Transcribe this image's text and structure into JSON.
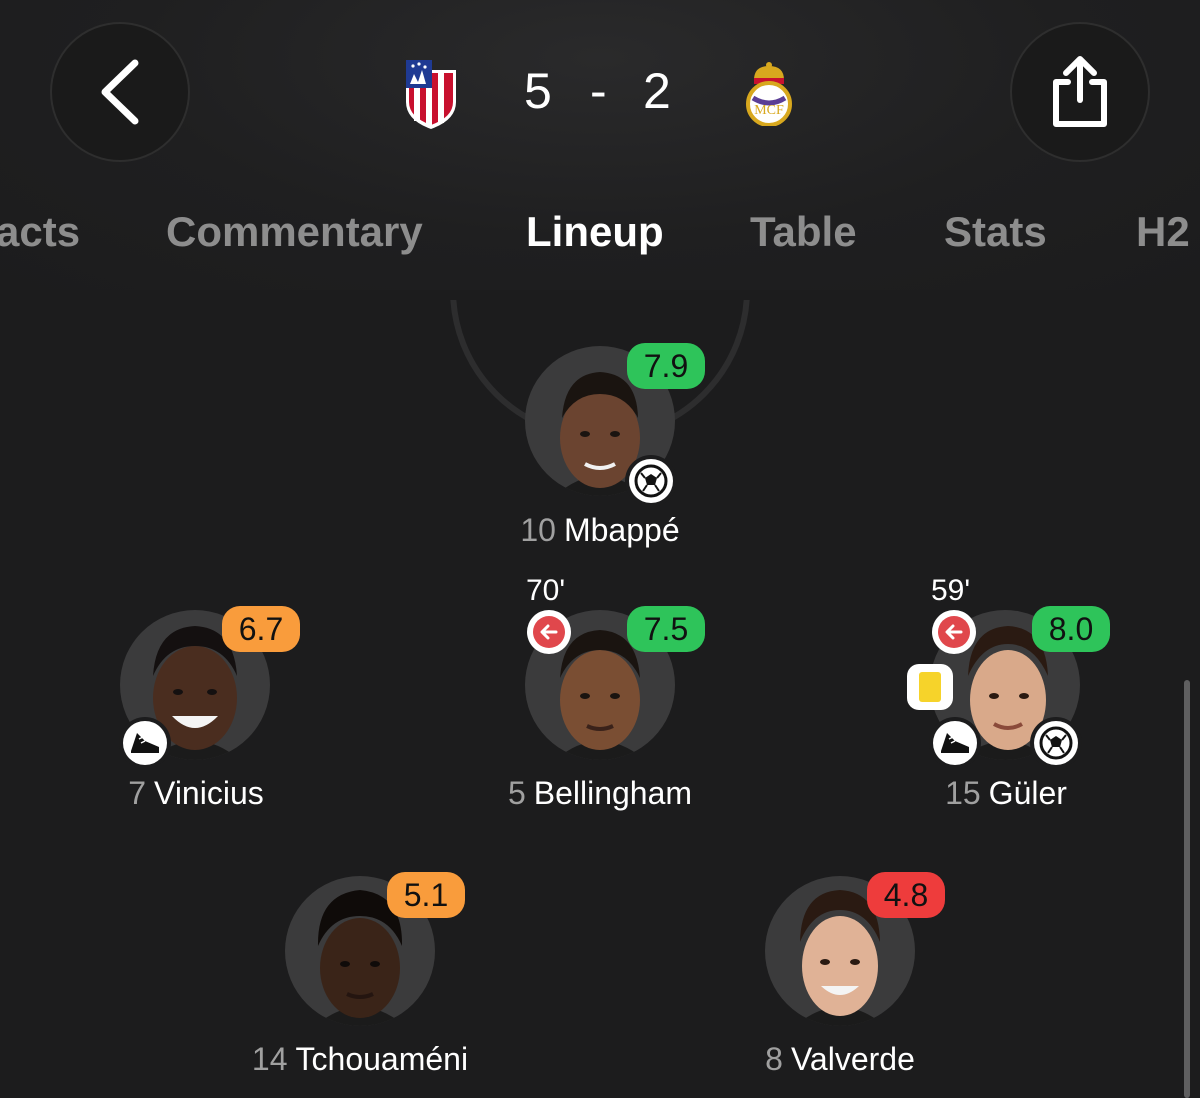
{
  "match": {
    "home_score": "5",
    "separator": "-",
    "away_score": "2",
    "home_crest_icon": "atletico-madrid-crest",
    "away_crest_icon": "real-madrid-crest"
  },
  "nav": {
    "back_icon": "chevron-left-icon",
    "share_icon": "share-icon"
  },
  "tabs": [
    {
      "label": "acts",
      "active": false
    },
    {
      "label": "Commentary",
      "active": false
    },
    {
      "label": "Lineup",
      "active": true
    },
    {
      "label": "Table",
      "active": false
    },
    {
      "label": "Stats",
      "active": false
    },
    {
      "label": "H2",
      "active": false
    }
  ],
  "players": [
    {
      "number": "10",
      "name": "Mbappé",
      "rating": "7.9",
      "rating_color": "green",
      "events": [
        "goal"
      ]
    },
    {
      "number": "7",
      "name": "Vinicius",
      "rating": "6.7",
      "rating_color": "orange",
      "events": [
        "assist"
      ]
    },
    {
      "number": "5",
      "name": "Bellingham",
      "rating": "7.5",
      "rating_color": "green",
      "sub_minute": "70'",
      "events": [
        "subbed-off"
      ]
    },
    {
      "number": "15",
      "name": "Güler",
      "rating": "8.0",
      "rating_color": "green",
      "sub_minute": "59'",
      "events": [
        "subbed-off",
        "yellow-card",
        "assist",
        "goal"
      ]
    },
    {
      "number": "14",
      "name": "Tchouaméni",
      "rating": "5.1",
      "rating_color": "orange",
      "events": []
    },
    {
      "number": "8",
      "name": "Valverde",
      "rating": "4.8",
      "rating_color": "red",
      "events": []
    }
  ],
  "colors": {
    "background": "#1c1c1d",
    "rating_green": "#2ec45a",
    "rating_orange": "#f99c3c",
    "rating_red": "#ee3c3c",
    "sub_red": "#e0474c",
    "yellow_card": "#f6d32a"
  }
}
